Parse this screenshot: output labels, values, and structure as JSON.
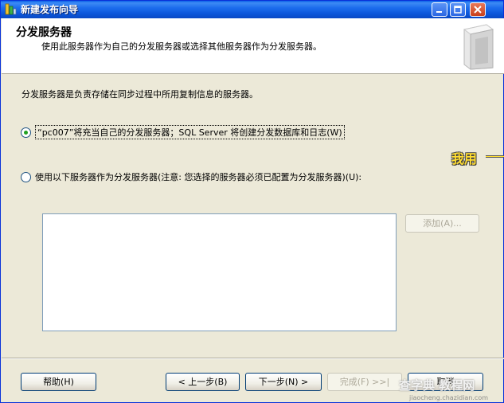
{
  "window": {
    "title": "新建发布向导"
  },
  "header": {
    "title": "分发服务器",
    "subtitle": "使用此服务器作为自己的分发服务器或选择其他服务器作为分发服务器。"
  },
  "main": {
    "description": "分发服务器是负责存储在同步过程中所用复制信息的服务器。",
    "options": [
      {
        "label": "“pc007”将充当自己的分发服务器；SQL Server 将创建分发数据库和日志(W)",
        "checked": true
      },
      {
        "label": "使用以下服务器作为分发服务器(注意: 您选择的服务器必须已配置为分发服务器)(U):",
        "checked": false
      }
    ],
    "add_button": "添加(A)...",
    "annotation": "我用"
  },
  "footer": {
    "help": "帮助(H)",
    "back": "< 上一步(B)",
    "next": "下一步(N) >",
    "finish": "完成(F) >>|",
    "cancel": "取消"
  },
  "watermark": {
    "text": "查字典 教程网",
    "url": "jiaocheng.chazidian.com"
  },
  "colors": {
    "titlebar": "#0b55d9",
    "window_bg": "#ece9d8",
    "annotation": "#ffdd33",
    "radio_dot": "#21a121"
  }
}
